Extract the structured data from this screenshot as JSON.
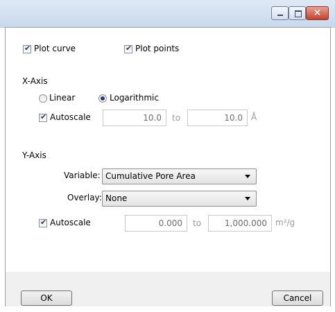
{
  "window": {
    "controls": {
      "minimize": "minimize-icon",
      "maximize": "maximize-icon",
      "close": "close-icon"
    }
  },
  "plot": {
    "curve_label": "Plot curve",
    "curve_checked": true,
    "points_label": "Plot points",
    "points_checked": true
  },
  "x_axis": {
    "heading": "X-Axis",
    "linear_label": "Linear",
    "logarithmic_label": "Logarithmic",
    "selected_scale": "Logarithmic",
    "autoscale_label": "Autoscale",
    "autoscale_checked": true,
    "from_value": "10.0",
    "to_label": "to",
    "to_value": "10.0",
    "unit": "Å"
  },
  "y_axis": {
    "heading": "Y-Axis",
    "variable_label": "Variable:",
    "variable_value": "Cumulative Pore Area",
    "overlay_label": "Overlay:",
    "overlay_value": "None",
    "autoscale_label": "Autoscale",
    "autoscale_checked": true,
    "from_value": "0.000",
    "to_label": "to",
    "to_value": "1,000.000",
    "unit": "m²/g"
  },
  "buttons": {
    "ok": "OK",
    "cancel": "Cancel"
  }
}
